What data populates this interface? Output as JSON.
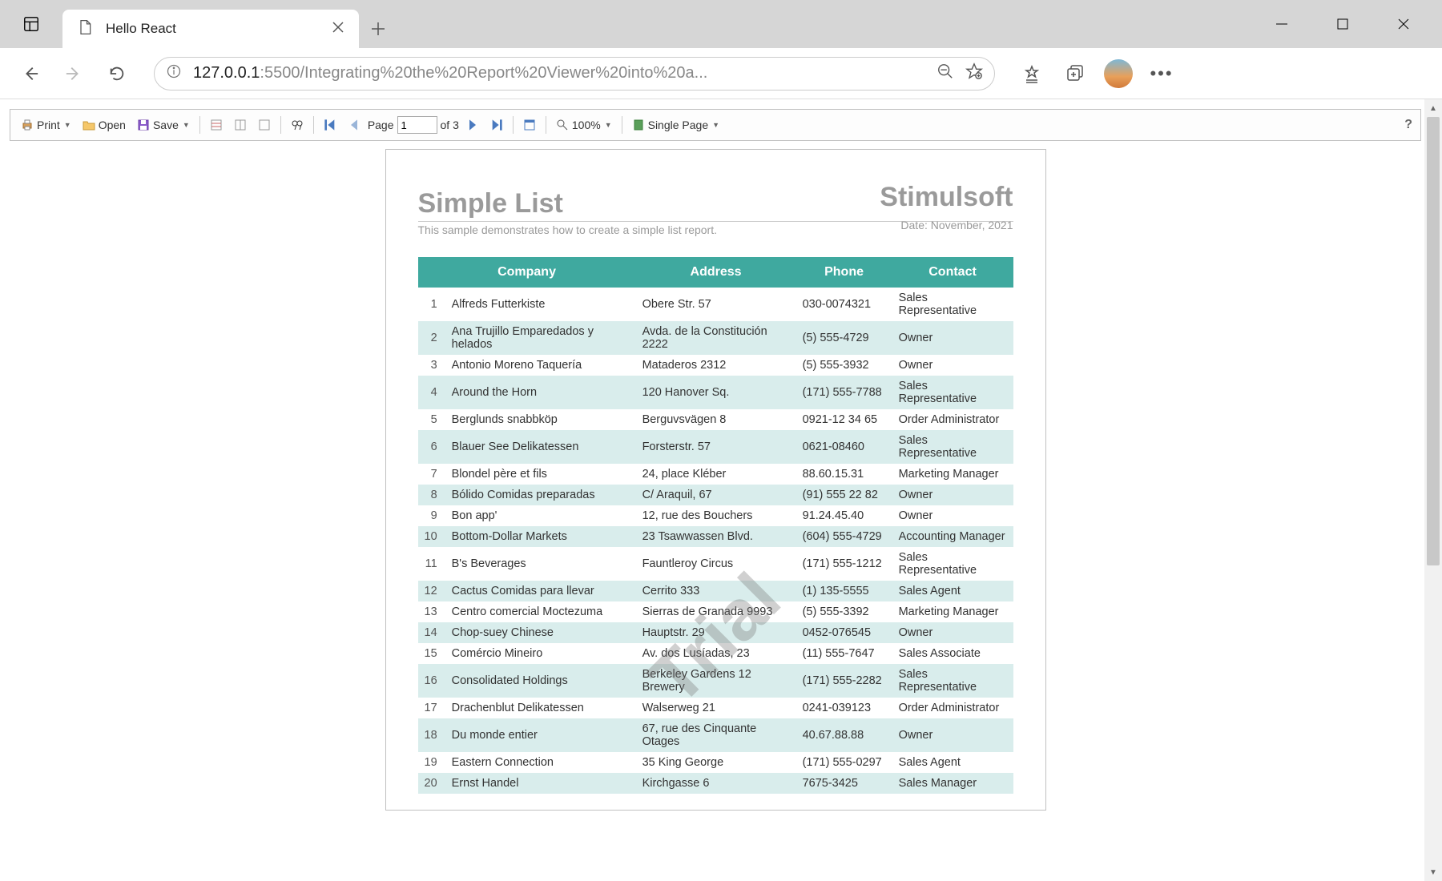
{
  "browser": {
    "tab_title": "Hello React",
    "url_host": "127.0.0.1",
    "url_port": ":5500",
    "url_path": "/Integrating%20the%20Report%20Viewer%20into%20a..."
  },
  "toolbar": {
    "print": "Print",
    "open": "Open",
    "save": "Save",
    "page_label": "Page",
    "page_value": "1",
    "page_of": "of 3",
    "zoom": "100%",
    "single_page": "Single Page",
    "help": "?"
  },
  "report": {
    "title": "Simple List",
    "brand": "Stimulsoft",
    "subtitle": "This sample demonstrates how to create a simple list report.",
    "date": "Date: November, 2021",
    "watermark": "Trial",
    "columns": {
      "company": "Company",
      "address": "Address",
      "phone": "Phone",
      "contact": "Contact"
    },
    "rows": [
      {
        "n": "1",
        "company": "Alfreds Futterkiste",
        "address": "Obere Str. 57",
        "phone": "030-0074321",
        "contact": "Sales Representative"
      },
      {
        "n": "2",
        "company": "Ana Trujillo Emparedados y helados",
        "address": "Avda. de la Constitución 2222",
        "phone": "(5) 555-4729",
        "contact": "Owner"
      },
      {
        "n": "3",
        "company": "Antonio Moreno Taquería",
        "address": "Mataderos  2312",
        "phone": "(5) 555-3932",
        "contact": "Owner"
      },
      {
        "n": "4",
        "company": "Around the Horn",
        "address": "120 Hanover Sq.",
        "phone": "(171) 555-7788",
        "contact": "Sales Representative"
      },
      {
        "n": "5",
        "company": "Berglunds snabbköp",
        "address": "Berguvsvägen  8",
        "phone": "0921-12 34 65",
        "contact": "Order Administrator"
      },
      {
        "n": "6",
        "company": "Blauer See Delikatessen",
        "address": "Forsterstr. 57",
        "phone": "0621-08460",
        "contact": "Sales Representative"
      },
      {
        "n": "7",
        "company": "Blondel père et fils",
        "address": "24, place Kléber",
        "phone": "88.60.15.31",
        "contact": "Marketing Manager"
      },
      {
        "n": "8",
        "company": "Bólido Comidas preparadas",
        "address": "C/ Araquil, 67",
        "phone": "(91) 555 22 82",
        "contact": "Owner"
      },
      {
        "n": "9",
        "company": "Bon app'",
        "address": "12, rue des Bouchers",
        "phone": "91.24.45.40",
        "contact": "Owner"
      },
      {
        "n": "10",
        "company": "Bottom-Dollar Markets",
        "address": "23 Tsawwassen Blvd.",
        "phone": "(604) 555-4729",
        "contact": "Accounting Manager"
      },
      {
        "n": "11",
        "company": "B's Beverages",
        "address": "Fauntleroy Circus",
        "phone": "(171) 555-1212",
        "contact": "Sales Representative"
      },
      {
        "n": "12",
        "company": "Cactus Comidas para llevar",
        "address": "Cerrito 333",
        "phone": "(1) 135-5555",
        "contact": "Sales Agent"
      },
      {
        "n": "13",
        "company": "Centro comercial Moctezuma",
        "address": "Sierras de Granada 9993",
        "phone": "(5) 555-3392",
        "contact": "Marketing Manager"
      },
      {
        "n": "14",
        "company": "Chop-suey Chinese",
        "address": "Hauptstr. 29",
        "phone": "0452-076545",
        "contact": "Owner"
      },
      {
        "n": "15",
        "company": "Comércio Mineiro",
        "address": "Av. dos Lusíadas, 23",
        "phone": "(11) 555-7647",
        "contact": "Sales Associate"
      },
      {
        "n": "16",
        "company": "Consolidated Holdings",
        "address": "Berkeley Gardens 12  Brewery",
        "phone": "(171) 555-2282",
        "contact": "Sales Representative"
      },
      {
        "n": "17",
        "company": "Drachenblut Delikatessen",
        "address": "Walserweg 21",
        "phone": "0241-039123",
        "contact": "Order Administrator"
      },
      {
        "n": "18",
        "company": "Du monde entier",
        "address": "67, rue des Cinquante Otages",
        "phone": "40.67.88.88",
        "contact": "Owner"
      },
      {
        "n": "19",
        "company": "Eastern Connection",
        "address": "35 King George",
        "phone": "(171) 555-0297",
        "contact": "Sales Agent"
      },
      {
        "n": "20",
        "company": "Ernst Handel",
        "address": "Kirchgasse 6",
        "phone": "7675-3425",
        "contact": "Sales Manager"
      }
    ]
  }
}
